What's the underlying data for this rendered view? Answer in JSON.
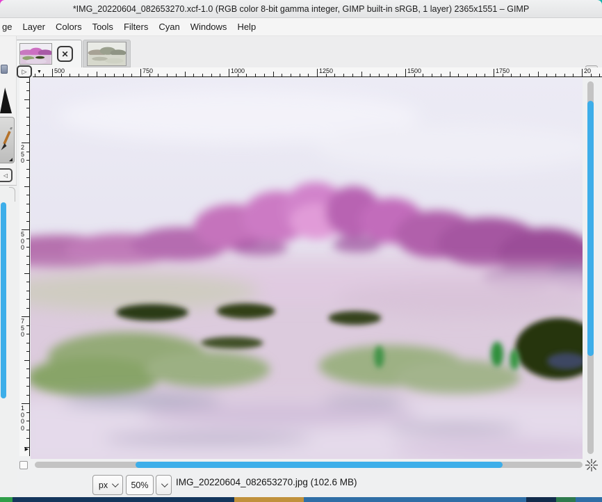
{
  "window": {
    "title": "*IMG_20220604_082653270.xcf-1.0 (RGB color 8-bit gamma integer, GIMP built-in sRGB, 1 layer) 2365x1551 – GIMP"
  },
  "menubar": {
    "items": [
      {
        "label": "ge"
      },
      {
        "label": "Layer"
      },
      {
        "label": "Colors"
      },
      {
        "label": "Tools"
      },
      {
        "label": "Filters"
      },
      {
        "label": "Cyan"
      },
      {
        "label": "Windows"
      },
      {
        "label": "Help"
      }
    ]
  },
  "tabbar": {
    "active_thumbnail": "pink-landscape-thumbnail",
    "inactive_thumbnail": "green-landscape-thumbnail"
  },
  "rulers": {
    "horizontal_labels": [
      "500",
      "750",
      "1000",
      "1250",
      "1500",
      "1750",
      "20"
    ],
    "vertical_labels": [
      "250",
      "500",
      "750",
      "1000"
    ]
  },
  "icons": {
    "close": "✕",
    "menu_triangle": "▷",
    "collapse_left": "◁",
    "ruler_marker_down": "▼",
    "ruler_marker_right": "▶"
  },
  "statusbar": {
    "unit_value": "px",
    "zoom_value": "50%",
    "message": "IMG_20220604_082653270.jpg (102.6 MB)"
  },
  "colors": {
    "accent_blue": "#3daee9",
    "scrollbar_trough": "#c3c3c3",
    "canvas_magenta": "#c06cb8"
  }
}
